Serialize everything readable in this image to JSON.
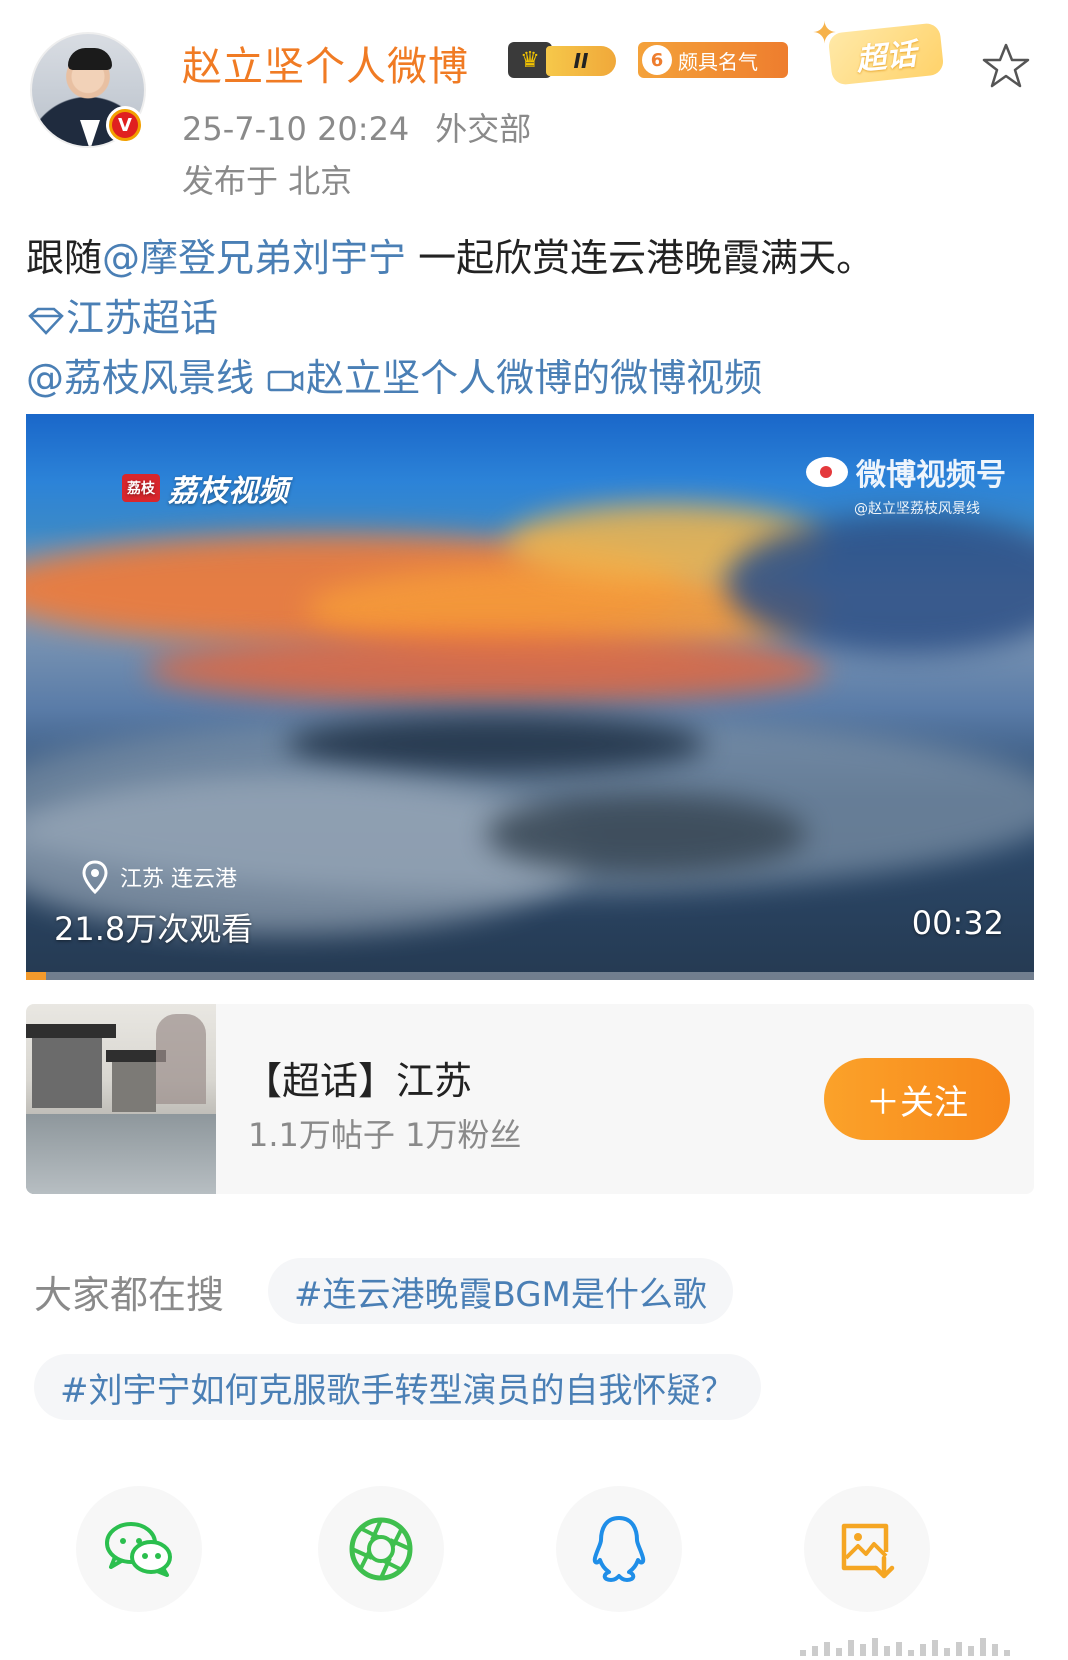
{
  "header": {
    "username": "赵立坚个人微博",
    "crown_level": "II",
    "fame_level": "6",
    "fame_label": "颇具名气",
    "chaohua_badge": "超话",
    "timestamp": "25-7-10 20:24",
    "source": "外交部",
    "location": "发布于 北京",
    "verified_mark": "V"
  },
  "post": {
    "line1_prefix": "跟随",
    "mention1": "@摩登兄弟刘宇宁",
    "line1_suffix": " 一起欣赏连云港晚霞满天。",
    "topic_link": "江苏超话",
    "mention2": "@荔枝风景线",
    "video_link": "赵立坚个人微博的微博视频"
  },
  "video": {
    "logo_mark": "荔枝",
    "logo_text": "荔枝视频",
    "watermark_brand": "微博视频号",
    "watermark_handle": "@赵立坚荔枝风景线",
    "location_tag": "江苏 连云港",
    "views": "21.8万次观看",
    "duration": "00:32",
    "progress": 0.02,
    "colors": {
      "progress": "#f39a2c"
    }
  },
  "topic_card": {
    "title": "【超话】江苏",
    "stats": "1.1万帖子 1万粉丝",
    "follow_label": "＋关注"
  },
  "search": {
    "label": "大家都在搜",
    "chips": [
      "#连云港晚霞BGM是什么歌",
      "#刘宇宁如何克服歌手转型演员的自我怀疑？"
    ]
  },
  "share": {
    "icons": [
      "wechat-icon",
      "moments-icon",
      "qq-icon",
      "save-image-icon"
    ]
  },
  "colors": {
    "accent": "#f07b24",
    "link": "#4a7fb5",
    "meta": "#8a8a8a"
  }
}
